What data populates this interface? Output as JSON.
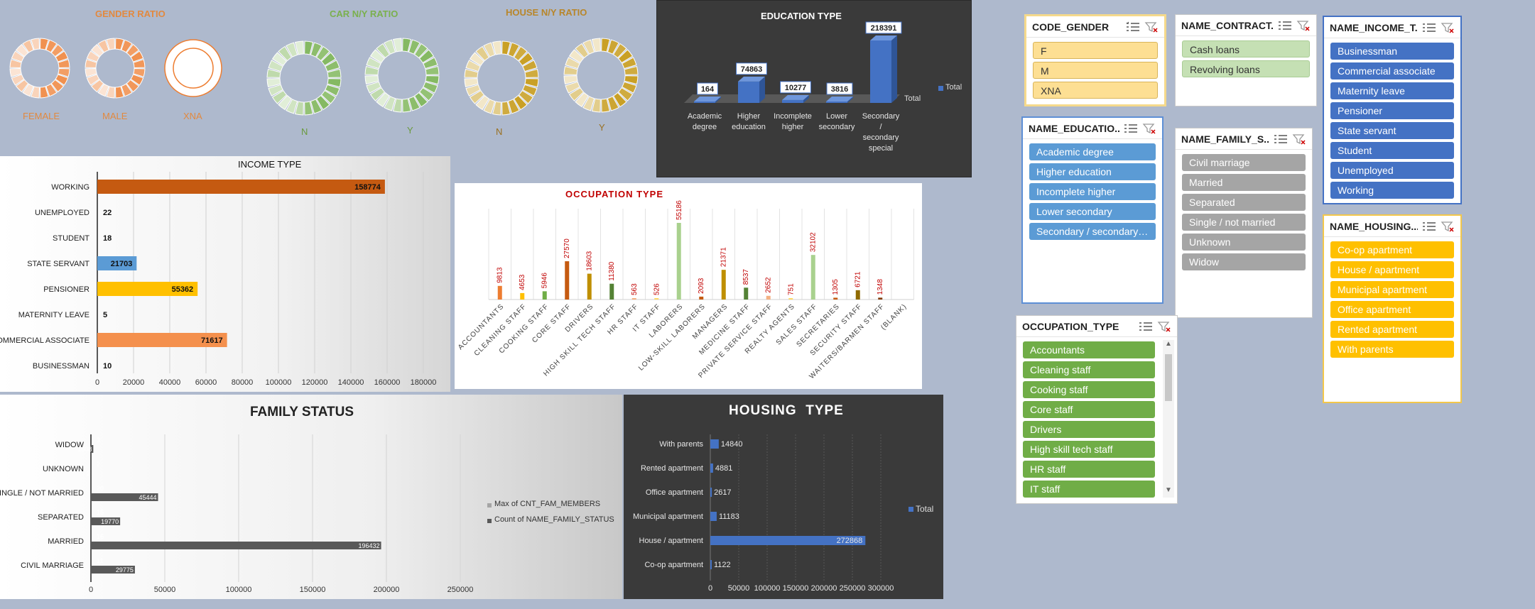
{
  "ratios": {
    "gender_title": "GENDER RATIO",
    "car_title": "CAR N/Y RATIO",
    "house_title": "HOUSE N/Y RATIO",
    "gender_labels": [
      "FEMALE",
      "MALE",
      "XNA"
    ],
    "car_labels": [
      "N",
      "Y"
    ],
    "house_labels": [
      "N",
      "Y"
    ],
    "colors": {
      "gender": "#ed7d31",
      "car": "#70ad47",
      "house": "#bf8f00"
    }
  },
  "education_chart": {
    "title": "EDUCATION TYPE",
    "legend": "Total",
    "axis_title": "Total",
    "chart_data": {
      "type": "bar",
      "title": "EDUCATION TYPE",
      "categories": [
        "Academic degree",
        "Higher education",
        "Incomplete higher",
        "Lower secondary",
        "Secondary / secondary special"
      ],
      "values": [
        164,
        74863,
        10277,
        3816,
        218391
      ],
      "series": [
        {
          "name": "Total",
          "values": [
            164,
            74863,
            10277,
            3816,
            218391
          ]
        }
      ]
    }
  },
  "income_chart": {
    "title": "INCOME TYPE",
    "chart_data": {
      "type": "bar",
      "title": "INCOME TYPE",
      "categories": [
        "WORKING",
        "UNEMPLOYED",
        "STUDENT",
        "STATE SERVANT",
        "PENSIONER",
        "MATERNITY LEAVE",
        "COMMERCIAL ASSOCIATE",
        "BUSINESSMAN"
      ],
      "values": [
        158774,
        22,
        18,
        21703,
        55362,
        5,
        71617,
        10
      ],
      "ticks": [
        "0",
        "20000",
        "40000",
        "60000",
        "80000",
        "100000",
        "120000",
        "140000",
        "160000",
        "180000"
      ],
      "xlim": [
        0,
        180000
      ]
    }
  },
  "occupation_chart": {
    "title": "OCCUPATION TYPE",
    "chart_data": {
      "type": "bar",
      "title": "OCCUPATION TYPE",
      "categories": [
        "ACCOUNTANTS",
        "CLEANING STAFF",
        "COOKING STAFF",
        "CORE STAFF",
        "DRIVERS",
        "HIGH SKILL TECH STAFF",
        "HR STAFF",
        "IT STAFF",
        "LABORERS",
        "LOW-SKILL LABORERS",
        "MANAGERS",
        "MEDICINE STAFF",
        "PRIVATE SERVICE STAFF",
        "REALTY AGENTS",
        "SALES STAFF",
        "SECRETARIES",
        "SECURITY STAFF",
        "WAITERS/BARMEN STAFF",
        "(BLANK)"
      ],
      "values": [
        9813,
        4653,
        5946,
        27570,
        18603,
        11380,
        563,
        526,
        55186,
        2093,
        21371,
        8537,
        2652,
        751,
        32102,
        1305,
        6721,
        1348,
        null
      ]
    }
  },
  "family_chart": {
    "title": "FAMILY STATUS",
    "chart_data": {
      "type": "bar",
      "title": "FAMILY STATUS",
      "categories": [
        "WIDOW",
        "UNKNOWN",
        "SINGLE / NOT MARRIED",
        "SEPARATED",
        "MARRIED",
        "CIVIL MARRIAGE"
      ],
      "series": [
        {
          "name": "Max of CNT_FAM_MEMBERS",
          "values": [
            3,
            2,
            20,
            15,
            16,
            11
          ]
        },
        {
          "name": "Count of NAME_FAMILY_STATUS",
          "values": [
            1608,
            2,
            45444,
            19770,
            196432,
            29775
          ]
        }
      ],
      "ticks": [
        "0",
        "50000",
        "100000",
        "150000",
        "200000",
        "250000"
      ],
      "xlim": [
        0,
        250000
      ]
    }
  },
  "housing_chart": {
    "title": "HOUSING  TYPE",
    "legend": "Total",
    "chart_data": {
      "type": "bar",
      "title": "HOUSING  TYPE",
      "categories": [
        "With parents",
        "Rented apartment",
        "Office apartment",
        "Municipal apartment",
        "House / apartment",
        "Co-op apartment"
      ],
      "values": [
        14840,
        4881,
        2617,
        11183,
        272868,
        1122
      ],
      "series": [
        {
          "name": "Total",
          "values": [
            14840,
            4881,
            2617,
            11183,
            272868,
            1122
          ]
        }
      ],
      "ticks": [
        "0",
        "50000",
        "100000",
        "150000",
        "200000",
        "250000",
        "300000"
      ],
      "xlim": [
        0,
        300000
      ]
    }
  },
  "slicers": {
    "code_gender": {
      "title": "CODE_GENDER",
      "items": [
        "F",
        "M",
        "XNA"
      ]
    },
    "contract": {
      "title": "NAME_CONTRACT...",
      "items": [
        "Cash loans",
        "Revolving loans"
      ]
    },
    "income": {
      "title": "NAME_INCOME_T...",
      "items": [
        "Businessman",
        "Commercial associate",
        "Maternity leave",
        "Pensioner",
        "State servant",
        "Student",
        "Unemployed",
        "Working"
      ]
    },
    "education": {
      "title": "NAME_EDUCATIO...",
      "items": [
        "Academic degree",
        "Higher education",
        "Incomplete higher",
        "Lower secondary",
        "Secondary / secondary s..."
      ]
    },
    "family": {
      "title": "NAME_FAMILY_S...",
      "items": [
        "Civil marriage",
        "Married",
        "Separated",
        "Single / not married",
        "Unknown",
        "Widow"
      ]
    },
    "housing": {
      "title": "NAME_HOUSING...",
      "items": [
        "Co-op apartment",
        "House / apartment",
        "Municipal apartment",
        "Office apartment",
        "Rented apartment",
        "With parents"
      ]
    },
    "occupation": {
      "title": "OCCUPATION_TYPE",
      "items": [
        "Accountants",
        "Cleaning staff",
        "Cooking staff",
        "Core staff",
        "Drivers",
        "High skill tech staff",
        "HR staff",
        "IT staff"
      ]
    }
  }
}
